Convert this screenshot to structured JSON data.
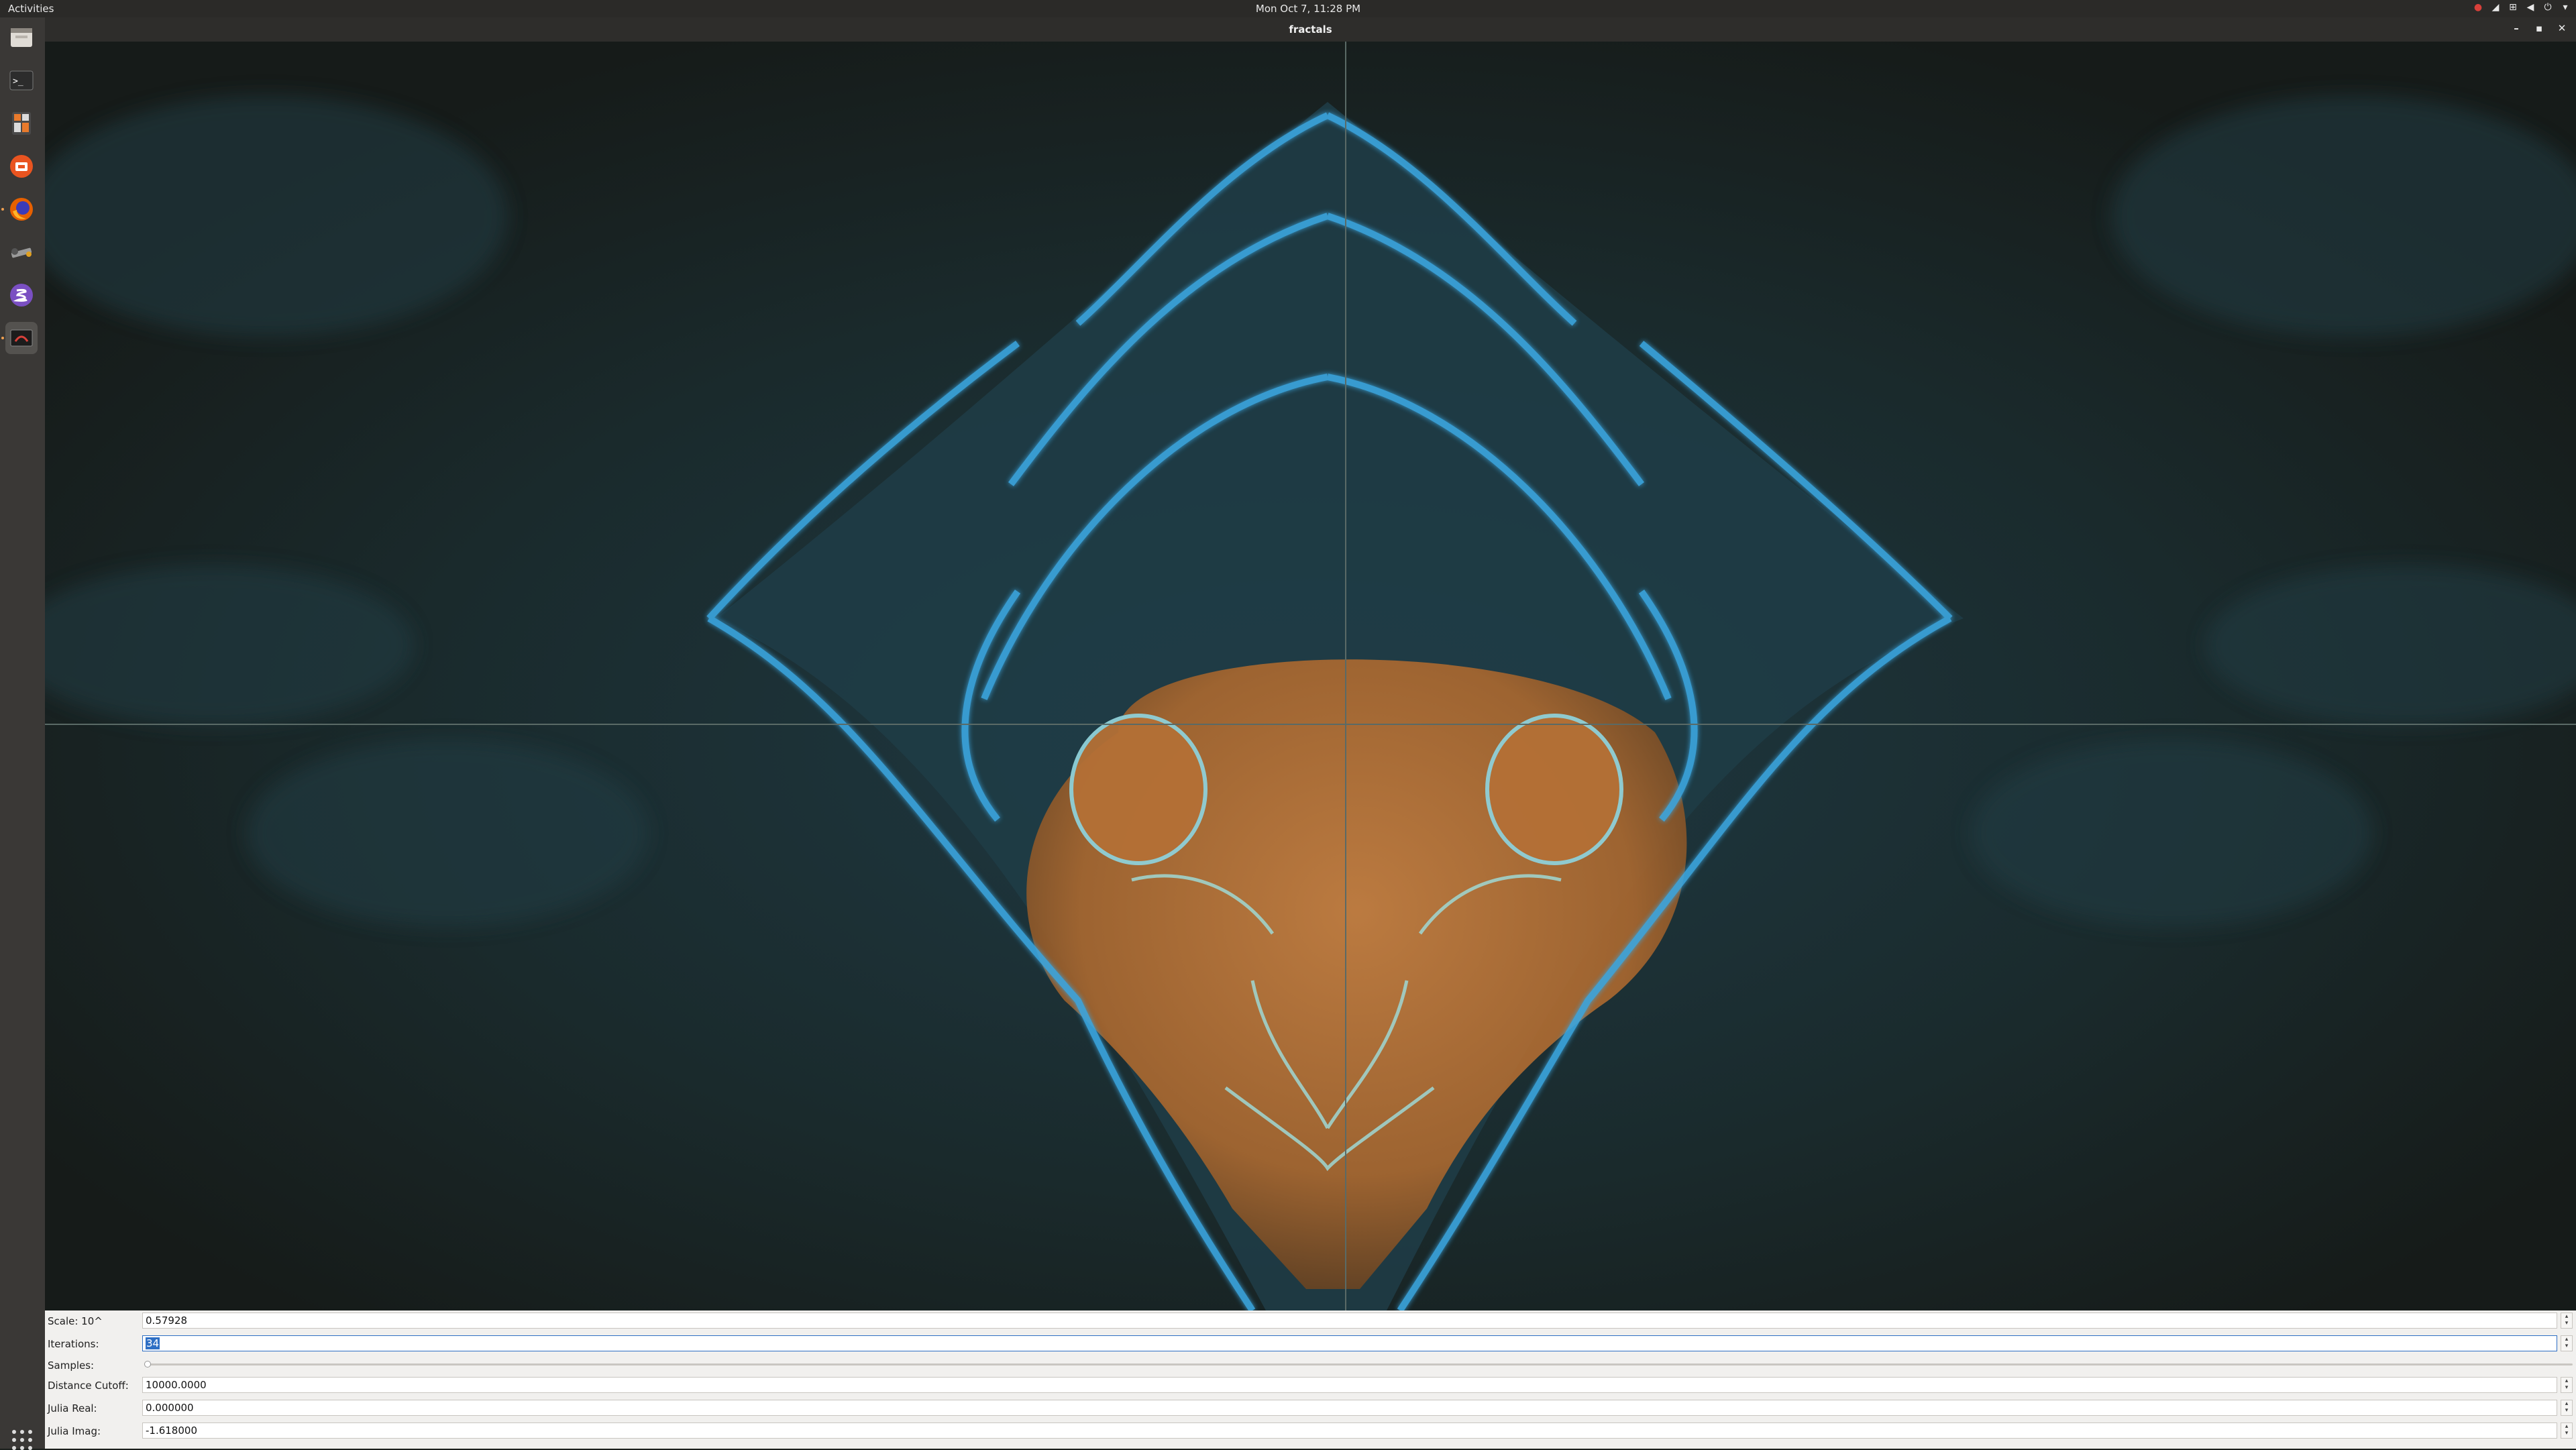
{
  "topbar": {
    "activities": "Activities",
    "clock": "Mon Oct  7, 11:28 PM",
    "tray_icons": [
      "record-icon",
      "wifi-icon",
      "network-icon",
      "volume-icon",
      "power-icon"
    ]
  },
  "dock": {
    "items": [
      "files-icon",
      "terminal-icon",
      "calculator-icon",
      "software-center-icon",
      "firefox-icon",
      "wrench-tool-icon",
      "emacs-icon",
      "fractals-app-icon"
    ]
  },
  "window": {
    "title": "fractals"
  },
  "controls": {
    "scale": {
      "label": "Scale: 10^",
      "value": "0.57928"
    },
    "iterations": {
      "label": "Iterations:",
      "value": "34"
    },
    "samples": {
      "label": "Samples:",
      "value_fraction": 0.0
    },
    "distance_cutoff": {
      "label": "Distance Cutoff:",
      "value": "10000.0000"
    },
    "julia_real": {
      "label": "Julia Real:",
      "value": "0.000000"
    },
    "julia_imag": {
      "label": "Julia Imag:",
      "value": "-1.618000"
    }
  },
  "colors": {
    "fractal_blue": "#3aa6e0",
    "fractal_orange": "#c9803a",
    "background": "#1a201d"
  }
}
